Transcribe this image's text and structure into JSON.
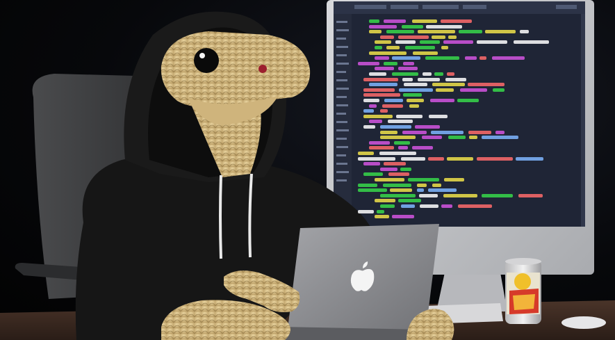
{
  "scene": {
    "subject": "snake-in-hoodie",
    "props": [
      "office-chair",
      "laptop",
      "desktop-monitor",
      "soda-can",
      "mouse",
      "keyboard",
      "desk"
    ],
    "colors": {
      "background": "#050505",
      "hoodie": "#161616",
      "snake_skin": "#d8c08a",
      "laptop": "#8e8e92",
      "monitor_frame": "#c6c7cb",
      "editor_bg": "#1f2536",
      "desk": "#3b2a22"
    }
  },
  "monitor": {
    "editor_title": "",
    "code_colors": [
      "#d455e0",
      "#37d84a",
      "#f0e24a",
      "#ff6b6b",
      "#7fb6ff",
      "#ffffff"
    ]
  },
  "laptop": {
    "logo": "apple-logo-icon"
  },
  "can": {
    "label": ""
  }
}
